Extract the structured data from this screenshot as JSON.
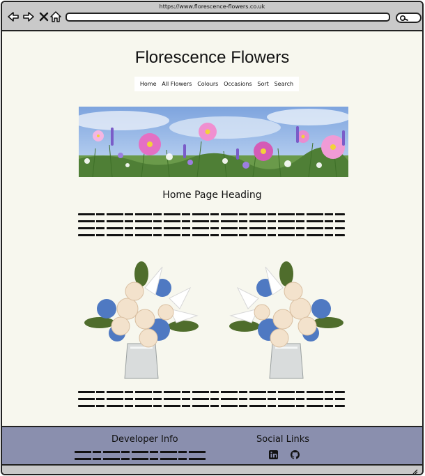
{
  "browser": {
    "url": "https://www.florescence-flowers.co.uk"
  },
  "site": {
    "title": "Florescence Flowers"
  },
  "nav": {
    "items": [
      "Home",
      "All Flowers",
      "Colours",
      "Occasions",
      "Sort",
      "Search"
    ]
  },
  "main": {
    "heading": "Home Page Heading"
  },
  "footer": {
    "developer_heading": "Developer Info",
    "social_heading": "Social Links",
    "social_icons": [
      "linkedin-icon",
      "github-icon"
    ]
  },
  "colors": {
    "page_bg": "#f7f7ee",
    "chrome": "#c9c9c9",
    "footer": "#8a8fae"
  }
}
